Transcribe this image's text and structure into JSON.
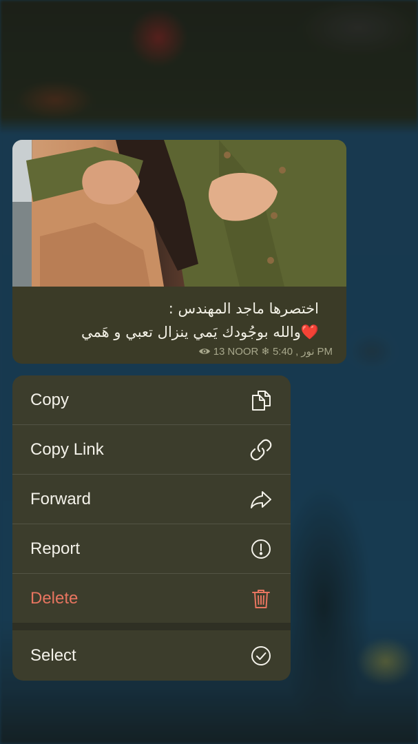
{
  "message": {
    "caption_line1": "اختصرها ماجد المهندس :",
    "caption_line2": "والله بوجُودك يَمي ينزال تعبي و هَمي",
    "heart": "❤️",
    "views": "13",
    "author": "NOOR",
    "time": "5:40",
    "signature": "نور",
    "period": "PM"
  },
  "menu": {
    "items": [
      {
        "label": "Copy",
        "icon": "copy-icon"
      },
      {
        "label": "Copy Link",
        "icon": "link-icon"
      },
      {
        "label": "Forward",
        "icon": "forward-icon"
      },
      {
        "label": "Report",
        "icon": "report-icon"
      },
      {
        "label": "Delete",
        "icon": "trash-icon"
      },
      {
        "label": "Select",
        "icon": "check-circle-icon"
      }
    ]
  },
  "colors": {
    "menu_bg": "#3c3d2c",
    "delete": "#e87560",
    "bubble_bg": "#3b3b27"
  }
}
